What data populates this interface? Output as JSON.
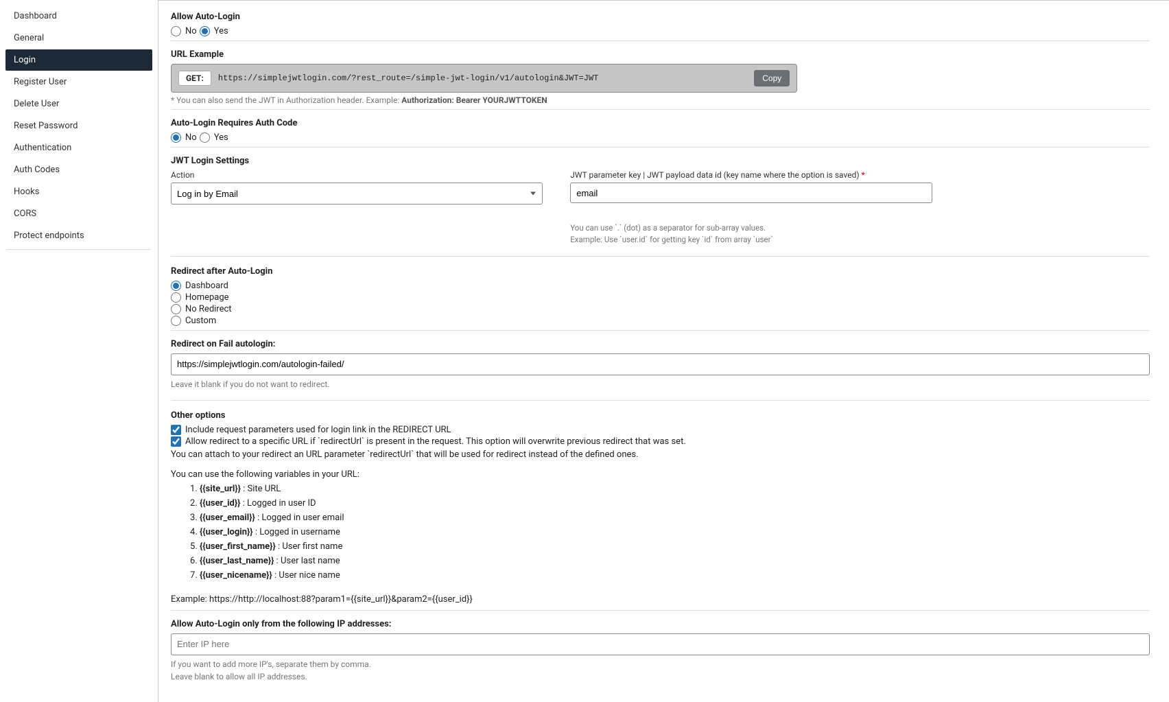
{
  "sidebar": {
    "items": [
      {
        "label": "Dashboard",
        "active": false
      },
      {
        "label": "General",
        "active": false
      },
      {
        "label": "Login",
        "active": true
      },
      {
        "label": "Register User",
        "active": false
      },
      {
        "label": "Delete User",
        "active": false
      },
      {
        "label": "Reset Password",
        "active": false
      },
      {
        "label": "Authentication",
        "active": false
      },
      {
        "label": "Auth Codes",
        "active": false
      },
      {
        "label": "Hooks",
        "active": false
      },
      {
        "label": "CORS",
        "active": false
      },
      {
        "label": "Protect endpoints",
        "active": false
      }
    ]
  },
  "allow_auto_login": {
    "title": "Allow Auto-Login",
    "options": {
      "no": "No",
      "yes": "Yes"
    },
    "selected": "yes"
  },
  "url_example": {
    "title": "URL Example",
    "method": "GET:",
    "url": "https://simplejwtlogin.com/?rest_route=/simple-jwt-login/v1/autologin&JWT=JWT",
    "copy": "Copy",
    "footnote_prefix": "* You can also send the JWT in Authorization header. Example: ",
    "footnote_bold": "Authorization: Bearer YOURJWTTOKEN"
  },
  "auth_code": {
    "title": "Auto-Login Requires Auth Code",
    "options": {
      "no": "No",
      "yes": "Yes"
    },
    "selected": "no"
  },
  "jwt_settings": {
    "title": "JWT Login Settings",
    "action_label": "Action",
    "action_value": "Log in by Email",
    "param_label": "JWT parameter key | JWT payload data id (key name where the option is saved)",
    "param_value": "email",
    "param_help1": "You can use `.` (dot) as a separator for sub-array values.",
    "param_help2": "Example: Use `user.id` for getting key `id` from array `user`"
  },
  "redirect_after": {
    "title": "Redirect after Auto-Login",
    "options": [
      "Dashboard",
      "Homepage",
      "No Redirect",
      "Custom"
    ],
    "selected": 0
  },
  "redirect_fail": {
    "title": "Redirect on Fail autologin:",
    "value": "https://simplejwtlogin.com/autologin-failed/",
    "help": "Leave it blank if you do not want to redirect."
  },
  "other": {
    "title": "Other options",
    "check1": "Include request parameters used for login link in the REDIRECT URL",
    "check2": "Allow redirect to a specific URL if `redirectUrl` is present in the request. This option will overwrite previous redirect that was set.",
    "desc": "You can attach to your redirect an URL parameter `redirectUrl` that will be used for redirect instead of the defined ones.",
    "vars_intro": "You can use the following variables in your URL:",
    "vars": [
      {
        "k": "{{site_url}}",
        "d": " : Site URL"
      },
      {
        "k": "{{user_id}}",
        "d": " : Logged in user ID"
      },
      {
        "k": "{{user_email}}",
        "d": " : Logged in user email"
      },
      {
        "k": "{{user_login}}",
        "d": " : Logged in username"
      },
      {
        "k": "{{user_first_name}}",
        "d": " : User first name"
      },
      {
        "k": "{{user_last_name}}",
        "d": " : User last name"
      },
      {
        "k": "{{user_nicename}}",
        "d": " : User nice name"
      }
    ],
    "example": "Example: https://http://localhost:88?param1={{site_url}}&param2={{user_id}}"
  },
  "ip": {
    "title": "Allow Auto-Login only from the following IP addresses:",
    "placeholder": "Enter IP here",
    "help1": "If you want to add more IP's, separate them by comma.",
    "help2": "Leave blank to allow all IP addresses."
  }
}
